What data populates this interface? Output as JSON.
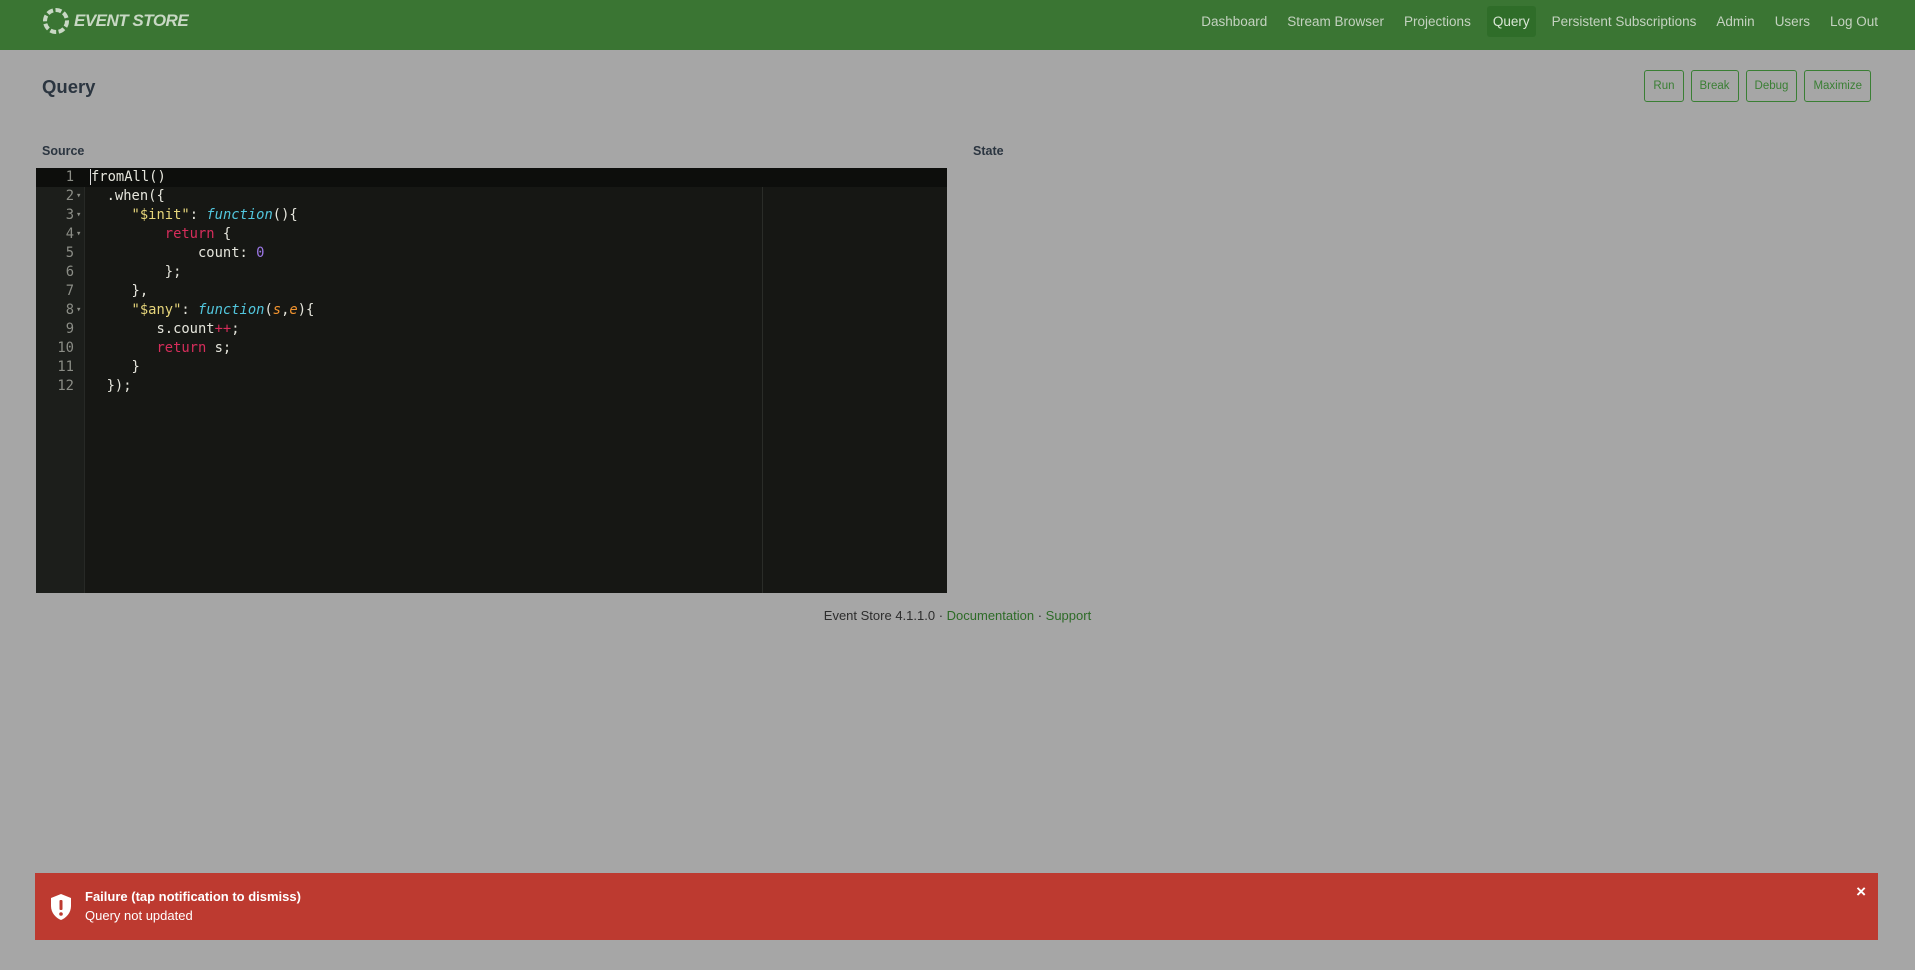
{
  "app": {
    "logo_text": "EVENT STORE"
  },
  "nav": [
    {
      "label": "Dashboard"
    },
    {
      "label": "Stream Browser"
    },
    {
      "label": "Projections"
    },
    {
      "label": "Query",
      "active": true
    },
    {
      "label": "Persistent Subscriptions"
    },
    {
      "label": "Admin"
    },
    {
      "label": "Users"
    },
    {
      "label": "Log Out"
    }
  ],
  "page": {
    "title": "Query"
  },
  "actions": {
    "run": "Run",
    "break": "Break",
    "debug": "Debug",
    "maximize": "Maximize"
  },
  "panels": {
    "source": "Source",
    "state": "State"
  },
  "editor": {
    "lines": [
      "fromAll()",
      "  .when({",
      "     \"$init\": function(){",
      "         return {",
      "             count: 0",
      "         };",
      "     },",
      "     \"$any\": function(s,e){",
      "        s.count++;",
      "        return s;",
      "     }",
      "  });"
    ]
  },
  "footer": {
    "version": "Event Store 4.1.1.0",
    "separator": " · ",
    "documentation": "Documentation",
    "support": "Support"
  },
  "notification": {
    "title": "Failure (tap notification to dismiss)",
    "message": "Query not updated",
    "close": "×",
    "color": "#bd3a30"
  },
  "colors": {
    "header": "#3a7533",
    "accent": "#3a7f34",
    "editor_bg": "#161714",
    "page_bg": "#a6a6a6"
  }
}
